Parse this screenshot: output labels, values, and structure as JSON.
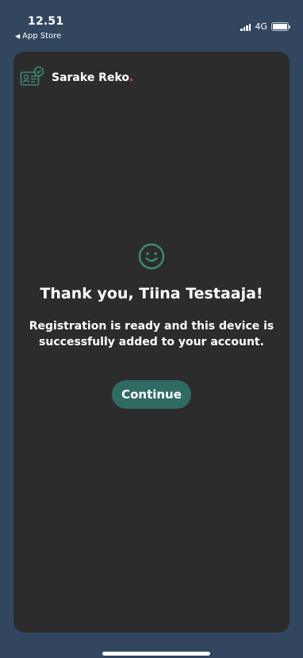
{
  "status_bar": {
    "time": "12.51",
    "back_app": "App Store",
    "network": "4G"
  },
  "brand": {
    "name": "Sarake Reko",
    "dot": ".",
    "icon": "id-card-check-icon"
  },
  "main": {
    "icon": "smiley-icon",
    "headline": "Thank you, Tiina Testaaja!",
    "message": "Registration is ready and this device is successfully added to your account.",
    "continue_label": "Continue"
  },
  "colors": {
    "background": "#33465f",
    "card": "#2c2c2c",
    "accent": "#2f6b62",
    "brand_dot": "#e05a47",
    "icon_green": "#3d8a7d"
  }
}
